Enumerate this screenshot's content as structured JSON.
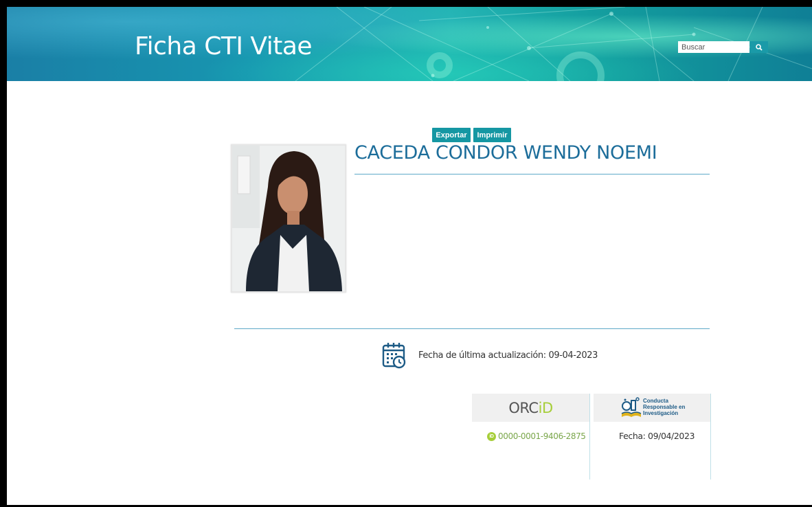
{
  "header": {
    "title": "Ficha CTI Vitae",
    "search_placeholder": "Buscar"
  },
  "actions": {
    "export_label": "Exportar",
    "print_label": "Imprimir"
  },
  "profile": {
    "name": "CACEDA CONDOR WENDY NOEMI",
    "last_update": "Fecha de última actualización: 09-04-2023"
  },
  "orcid": {
    "logo_left": "ORC",
    "logo_right": "iD",
    "badge": "iD",
    "id": "0000-0001-9406-2875"
  },
  "cri": {
    "label_line1": "Conducta",
    "label_line2": "Responsable en",
    "label_line3": "Investigación",
    "date": "Fecha:  09/04/2023"
  },
  "colors": {
    "accent": "#1597a3",
    "name_color": "#1c6d9a",
    "orcid_green": "#a6ce39"
  }
}
